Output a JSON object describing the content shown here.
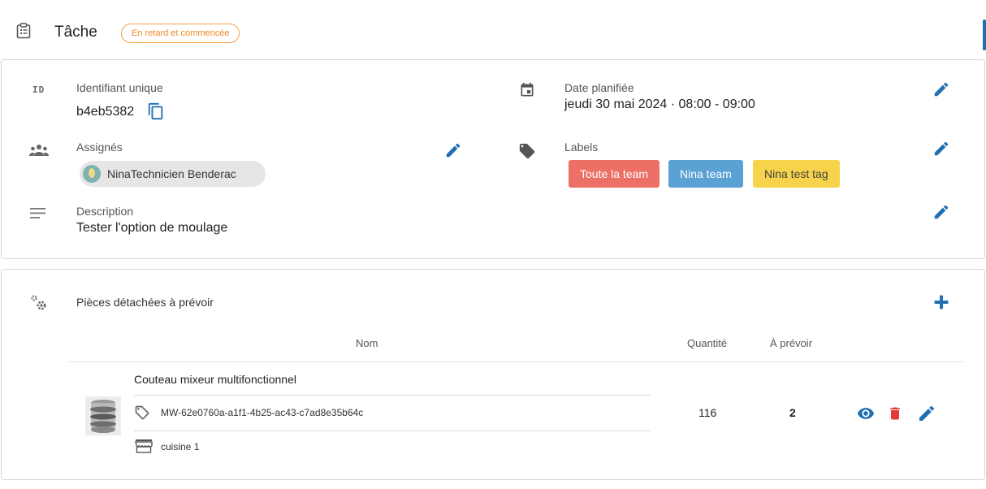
{
  "header": {
    "title": "Tâche",
    "status": "En retard et commencée"
  },
  "details": {
    "id_label": "Identifiant unique",
    "id_value": "b4eb5382",
    "id_icon_text": "ID",
    "date_label": "Date planifiée",
    "date_value": "jeudi 30 mai 2024 · 08:00 - 09:00",
    "assignees_label": "Assignés",
    "assignee_name": "NinaTechnicien Benderac",
    "labels_label": "Labels",
    "labels": [
      {
        "text": "Toute la team",
        "color": "#ec7066"
      },
      {
        "text": "Nina team",
        "color": "#5aa1d4"
      },
      {
        "text": "Nina test tag",
        "color": "#f6d34a"
      }
    ],
    "description_label": "Description",
    "description_value": "Tester l'option de moulage"
  },
  "parts": {
    "title": "Pièces détachées à prévoir",
    "columns": {
      "name": "Nom",
      "quantity": "Quantité",
      "to_plan": "À prévoir"
    },
    "rows": [
      {
        "name": "Couteau mixeur multifonctionnel",
        "reference": "MW-62e0760a-a1f1-4b25-ac43-c7ad8e35b64c",
        "location": "cuisine 1",
        "quantity": "116",
        "to_plan": "2"
      }
    ]
  },
  "colors": {
    "accent": "#1f6fb2",
    "status_orange": "#f08a24",
    "delete_red": "#e53935"
  }
}
